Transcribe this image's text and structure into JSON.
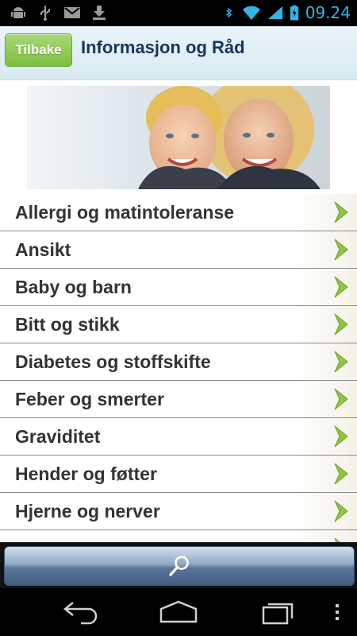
{
  "status_bar": {
    "time": "09.24",
    "icons": [
      "android-debug-icon",
      "usb-icon",
      "gmail-icon",
      "download-icon",
      "bluetooth-icon",
      "wifi-icon",
      "signal-icon",
      "battery-charging-icon"
    ]
  },
  "header": {
    "back_label": "Tilbake",
    "title": "Informasjon og Råd"
  },
  "topics": [
    "Allergi og matintoleranse",
    "Ansikt",
    "Baby og barn",
    "Bitt og stikk",
    "Diabetes og stoffskifte",
    "Feber og smerter",
    "Graviditet",
    "Hender og føtter",
    "Hjerne og nerver",
    ""
  ],
  "search": {
    "icon": "search-icon"
  },
  "nav": {
    "icons": [
      "back-icon",
      "home-icon",
      "recent-apps-icon",
      "overflow-menu-icon"
    ]
  },
  "colors": {
    "accent_green": "#7cbf3e",
    "title_blue": "#15375a",
    "time_blue": "#33b5e5"
  }
}
